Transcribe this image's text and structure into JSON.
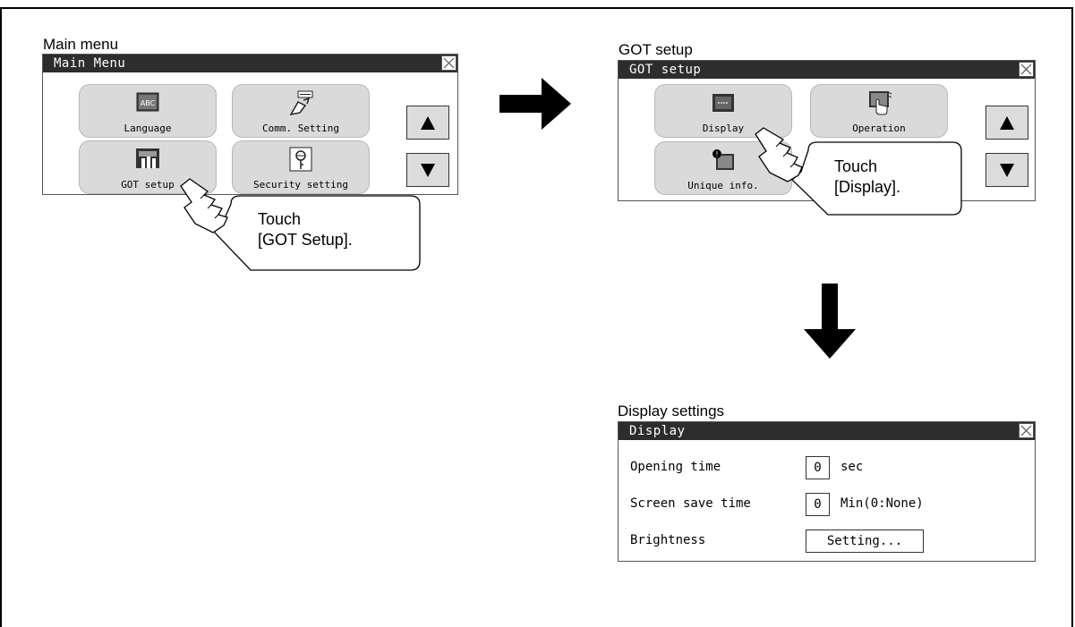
{
  "main_menu": {
    "caption": "Main menu",
    "title": "Main Menu",
    "tiles": [
      {
        "label": "Language",
        "icon": "language-abc-icon"
      },
      {
        "label": "Comm. Setting",
        "icon": "comm-setting-icon"
      },
      {
        "label": "GOT setup",
        "icon": "got-setup-icon"
      },
      {
        "label": "Security setting",
        "icon": "security-key-icon"
      }
    ],
    "callout": {
      "line1": "Touch",
      "line2": "[GOT Setup]."
    }
  },
  "got_setup": {
    "caption": "GOT setup",
    "title": "GOT setup",
    "tiles": [
      {
        "label": "Display",
        "icon": "display-icon"
      },
      {
        "label": "Operation",
        "icon": "operation-icon"
      },
      {
        "label": "Unique info.",
        "icon": "unique-info-icon"
      }
    ],
    "callout": {
      "line1": "Touch",
      "line2": "[Display]."
    }
  },
  "display_settings": {
    "caption": "Display settings",
    "title": "Display",
    "rows": [
      {
        "label": "Opening time",
        "value": "0",
        "unit": "sec"
      },
      {
        "label": "Screen save time",
        "value": "0",
        "unit": "Min(0:None)"
      },
      {
        "label": "Brightness",
        "button": "Setting..."
      }
    ]
  },
  "icons": {
    "close": "close-x-icon",
    "up": "scroll-up-triangle-icon",
    "down": "scroll-down-triangle-icon",
    "arrow_right": "flow-arrow-right-icon",
    "arrow_down": "flow-arrow-down-icon",
    "hand": "pointing-hand-icon"
  }
}
